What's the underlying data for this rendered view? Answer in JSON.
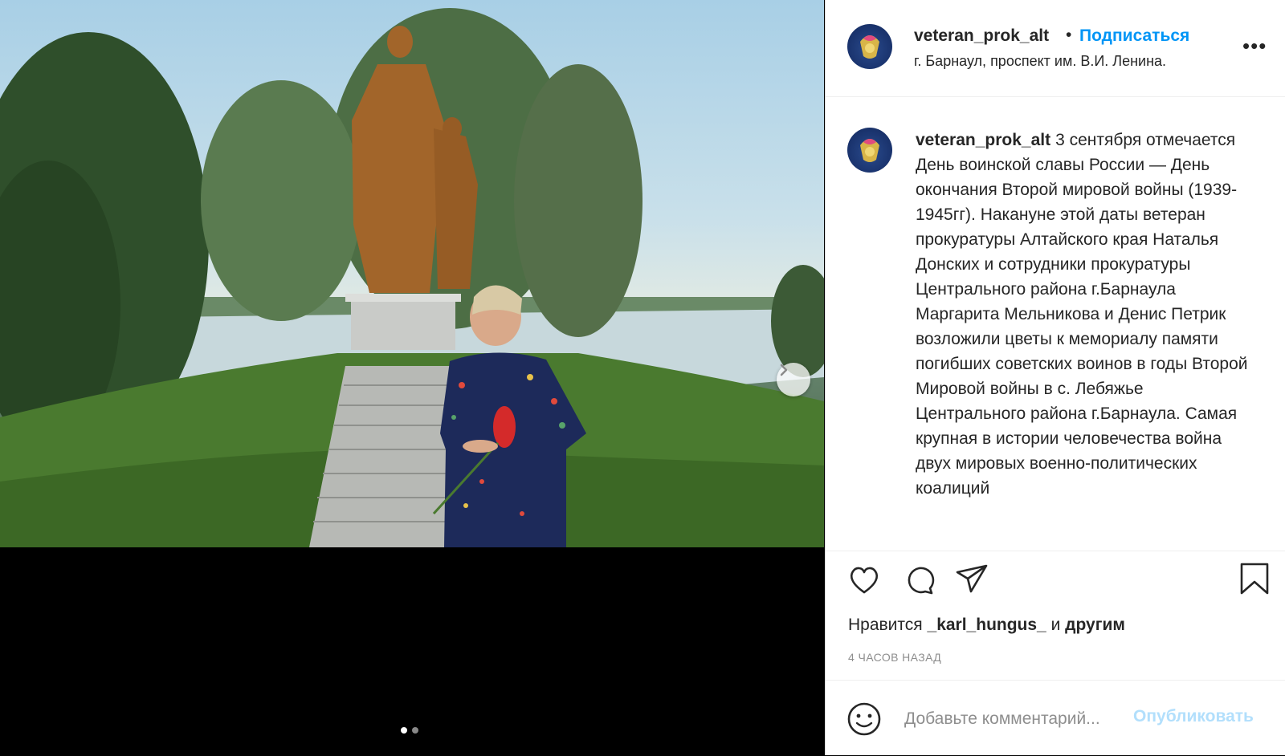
{
  "post": {
    "username": "veteran_prok_alt",
    "separator": "•",
    "follow_label": "Подписаться",
    "location": "г. Барнаул, проспект им. В.И. Ленина.",
    "more_icon": "more-options-icon",
    "caption_text": "3 сентября отмечается День воинской славы России — День окончания Второй мировой войны (1939-1945гг). Накануне этой даты ветеран прокуратуры Алтайского края Наталья Донских и сотрудники прокуратуры Центрального района г.Барнаула Маргарита Мельникова и Денис Петрик возложили цветы к мемориалу памяти погибших советских воинов в годы Второй Мировой войны в с. Лебяжье Центрального района г.Барнаула. Самая крупная в истории человечества война двух мировых военно-политических коалиций",
    "likes_prefix": "Нравится",
    "likes_user": "_karl_hungus_",
    "likes_and": "и",
    "likes_others": "другим",
    "time_ago": "4 ЧАСОВ НАЗАД",
    "comment_placeholder": "Добавьте комментарий...",
    "publish_label": "Опубликовать"
  },
  "carousel": {
    "slide_count": 2,
    "active_slide": 1
  },
  "colors": {
    "link_blue": "#0095f6",
    "publish_disabled": "#b2dffc",
    "secondary_text": "#8e8e8e"
  }
}
